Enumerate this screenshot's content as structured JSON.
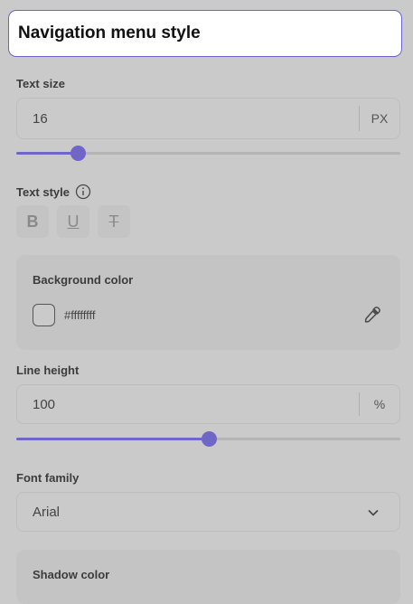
{
  "header": {
    "title": "Navigation menu style"
  },
  "text_size": {
    "label": "Text size",
    "value": "16",
    "unit": "PX",
    "slider_fraction": 0.16
  },
  "text_style": {
    "label": "Text style",
    "bold": "B",
    "underline": "U",
    "strikethrough": "T"
  },
  "background_color": {
    "label": "Background color",
    "value": "#ffffffff"
  },
  "line_height": {
    "label": "Line height",
    "value": "100",
    "unit": "%",
    "slider_fraction": 0.5
  },
  "font_family": {
    "label": "Font family",
    "value": "Arial"
  },
  "shadow_color": {
    "label": "Shadow color"
  },
  "colors": {
    "accent": "#6f66c8",
    "background": "#cacaca",
    "header_border": "#6b63c9"
  }
}
